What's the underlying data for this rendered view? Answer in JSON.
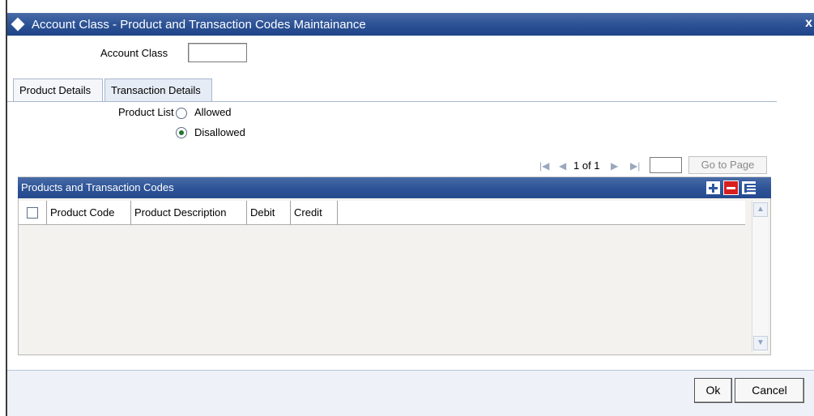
{
  "window": {
    "title": "Account Class - Product and Transaction Codes Maintainance",
    "close_glyph": "x"
  },
  "form": {
    "account_class_label": "Account Class",
    "account_class_value": ""
  },
  "tabs": [
    {
      "label": "Product Details",
      "active": false
    },
    {
      "label": "Transaction Details",
      "active": true
    }
  ],
  "product_list": {
    "label": "Product List",
    "options": [
      {
        "label": "Allowed",
        "checked": false
      },
      {
        "label": "Disallowed",
        "checked": true
      }
    ]
  },
  "pager": {
    "page_text": "1 of 1",
    "page_input": "",
    "goto_label": "Go to Page",
    "icons": [
      "first-page-icon",
      "previous-page-icon",
      "next-page-icon",
      "last-page-icon"
    ]
  },
  "grid": {
    "title": "Products and Transaction Codes",
    "columns": [
      "Product Code",
      "Product Description",
      "Debit",
      "Credit"
    ],
    "rows": [],
    "actions": [
      "add-row-icon",
      "delete-row-icon",
      "single-view-icon"
    ]
  },
  "footer": {
    "ok_label": "Ok",
    "cancel_label": "Cancel"
  },
  "colors": {
    "title_bar": "#2f5598",
    "grid_header": "#2f5598",
    "footer_bg": "#eef2f8",
    "grid_bg": "#f3f2ee"
  }
}
